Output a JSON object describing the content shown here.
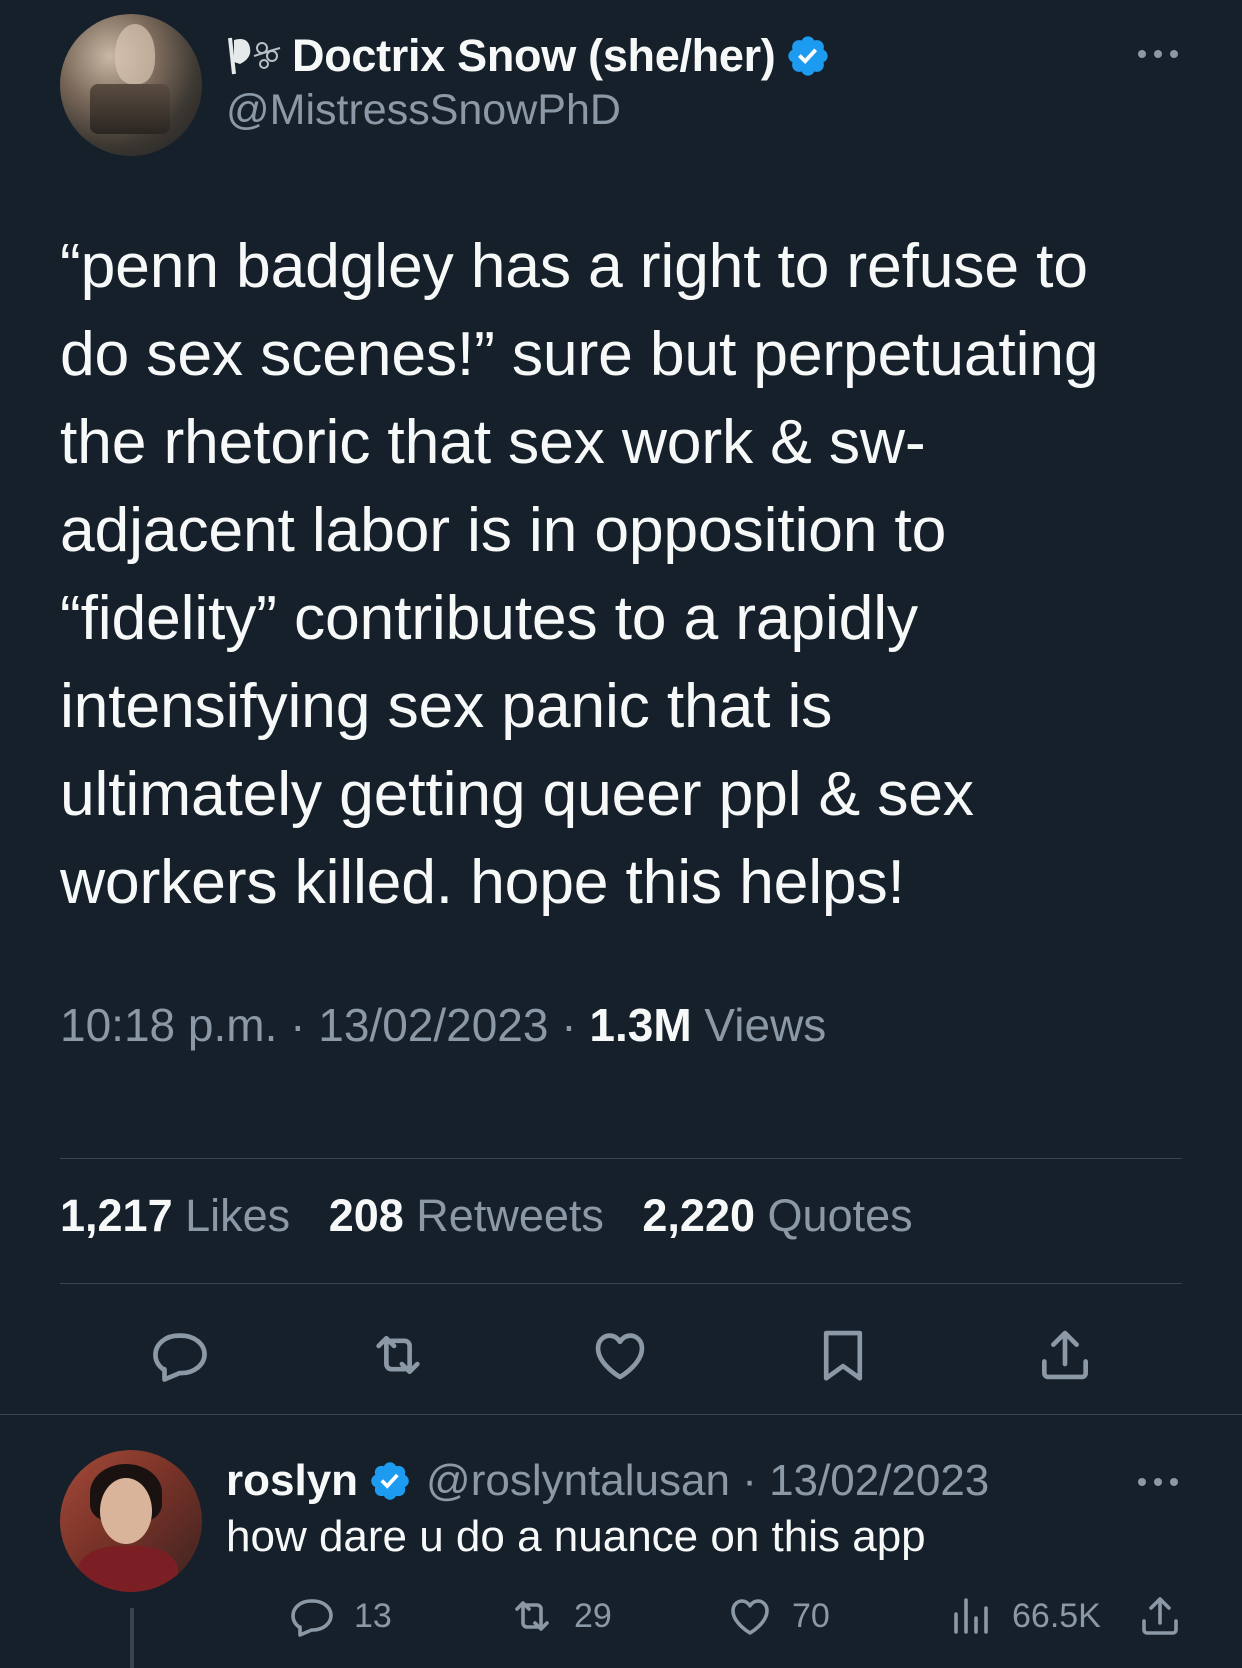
{
  "tweet": {
    "author": {
      "display_name": "Doctrix Snow (she/her)",
      "handle": "@MistressSnowPhD",
      "verified": true
    },
    "text": "“penn badgley has a right to refuse to\ndo sex scenes!” sure but perpetuating\nthe rhetoric that sex work & sw-\nadjacent labor is in opposition to\n“fidelity” contributes to a rapidly\nintensifying sex panic that is\nultimately getting queer ppl & sex\nworkers killed. hope this helps!",
    "time": "10:18 p.m.",
    "separator": " · ",
    "date": "13/02/2023",
    "views_count": "1.3M",
    "views_label": " Views",
    "stats": {
      "likes_count": "1,217",
      "likes_label": " Likes",
      "retweets_count": "208",
      "retweets_label": " Retweets",
      "quotes_count": "2,220",
      "quotes_label": " Quotes"
    }
  },
  "reply": {
    "display_name": "roslyn",
    "handle_and_date": "@roslyntalusan · 13/02/2023",
    "verified": true,
    "text": "how dare u do a nuance on this app",
    "replies": "13",
    "retweets": "29",
    "likes": "70",
    "views": "66.5K"
  },
  "icons": {
    "name_emoji": "emoji-icon",
    "verified": "verified-badge-icon",
    "more": "more-options-icon",
    "reply": "reply-icon",
    "retweet": "retweet-icon",
    "like": "heart-icon",
    "bookmark": "bookmark-icon",
    "share": "share-icon",
    "views": "views-icon"
  },
  "colors": {
    "background": "#15202b",
    "text_primary": "#f7f9f9",
    "text_secondary": "#8b98a5",
    "divider": "#38444d",
    "verified_blue": "#1d9bf0"
  }
}
